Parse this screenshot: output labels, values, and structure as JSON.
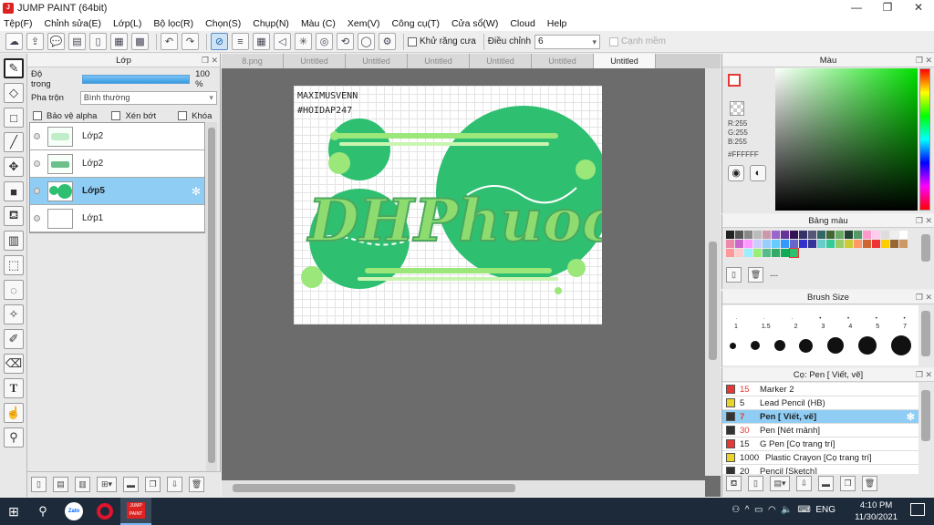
{
  "window": {
    "title": "JUMP PAINT (64bit)",
    "minimize": "—",
    "maximize": "❐",
    "close": "✕"
  },
  "menu": [
    "Tệp(F)",
    "Chỉnh sửa(E)",
    "Lớp(L)",
    "Bộ lọc(R)",
    "Chọn(S)",
    "Chụp(N)",
    "Màu (C)",
    "Xem(V)",
    "Công cụ(T)",
    "Cửa sổ(W)",
    "Cloud",
    "Help"
  ],
  "toolbar": {
    "antialias_label": "Khử răng cưa",
    "adjust_label": "Điều chỉnh",
    "adjust_value": "6",
    "smooth_label": "Cạnh mềm"
  },
  "layer_panel": {
    "title": "Lớp",
    "opacity_label": "Độ trong",
    "opacity_value": "100 %",
    "blend_label": "Pha trộn",
    "blend_value": "Bình thường",
    "protect_alpha": "Bảo vệ alpha",
    "clipping": "Xén bớt",
    "lock": "Khóa",
    "layers": [
      {
        "name": "Lớp2",
        "selected": false
      },
      {
        "name": "Lớp2",
        "selected": false
      },
      {
        "name": "Lớp5",
        "selected": true
      },
      {
        "name": "Lớp1",
        "selected": false
      }
    ]
  },
  "tabs": [
    "8.png",
    "Untitled",
    "Untitled",
    "Untitled",
    "Untitled",
    "Untitled",
    "Untitled"
  ],
  "active_tab_index": 6,
  "canvas": {
    "text_line1": "MAXIMUSVENN",
    "text_line2": "#HOIDAP247",
    "main_text": "DHPhuoc"
  },
  "color_panel": {
    "title": "Màu",
    "r": "R:255",
    "g": "G:255",
    "b": "B:255",
    "hex": "#FFFFFF"
  },
  "swatch_panel": {
    "title": "Bảng màu",
    "footer": "---"
  },
  "brush_panel": {
    "title": "Brush Size",
    "sizes": [
      "1",
      "1.5",
      "2",
      "3",
      "4",
      "5",
      "7"
    ]
  },
  "pen_panel": {
    "title": "Cọ: Pen [ Viết, vẽ]",
    "pens": [
      {
        "color": "#e53935",
        "size": "15",
        "name": "Marker 2",
        "selected": false
      },
      {
        "color": "#e8d42a",
        "size": "5",
        "name": "Lead Pencil (HB)",
        "selected": false
      },
      {
        "color": "#333333",
        "size": "7",
        "name": "Pen [ Viết, vẽ]",
        "selected": true
      },
      {
        "color": "#333333",
        "size": "30",
        "name": "Pen [Nét mảnh]",
        "selected": false
      },
      {
        "color": "#e53935",
        "size": "15",
        "name": "G Pen [Cọ trang trí]",
        "selected": false
      },
      {
        "color": "#e8d42a",
        "size": "1000",
        "name": "Plastic Crayon [Cọ trang trí]",
        "selected": false
      },
      {
        "color": "#333333",
        "size": "20",
        "name": "Pencil [Sketch]",
        "selected": false
      }
    ]
  },
  "taskbar": {
    "time": "4:10 PM",
    "date": "11/30/2021",
    "lang": "ENG",
    "zalo": "Zalo"
  },
  "colors": {
    "accent": "#8fcdf4",
    "green": "#2fbf71",
    "light_green": "#9be77a"
  }
}
